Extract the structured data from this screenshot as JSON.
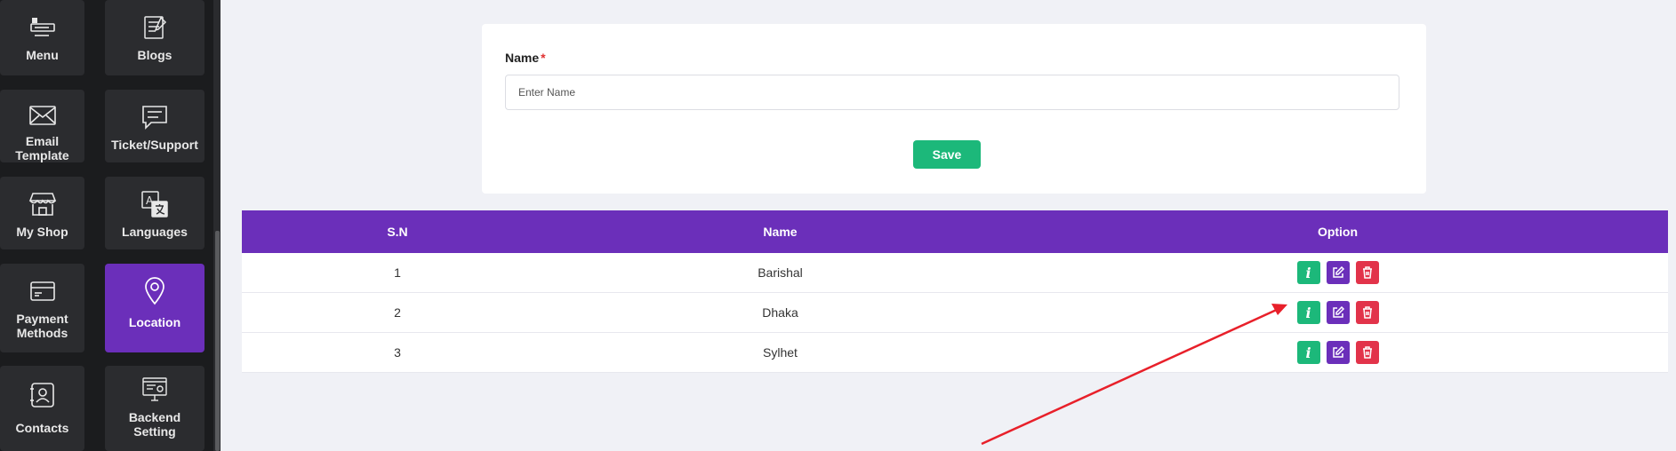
{
  "sidebar": {
    "items": [
      {
        "label": "Menu",
        "icon": "menu-icon"
      },
      {
        "label": "Blogs",
        "icon": "blog-icon"
      },
      {
        "label": "Email Template",
        "icon": "envelope-icon"
      },
      {
        "label": "Ticket/Support",
        "icon": "chat-icon"
      },
      {
        "label": "My Shop",
        "icon": "shop-icon"
      },
      {
        "label": "Languages",
        "icon": "translate-icon"
      },
      {
        "label": "Payment Methods",
        "icon": "card-icon"
      },
      {
        "label": "Location",
        "icon": "location-pin-icon",
        "active": true
      },
      {
        "label": "Contacts",
        "icon": "contact-book-icon"
      },
      {
        "label": "Backend Setting",
        "icon": "settings-monitor-icon"
      }
    ]
  },
  "form": {
    "name_label": "Name",
    "required_mark": "*",
    "name_placeholder": "Enter Name",
    "name_value": "",
    "save_label": "Save"
  },
  "table": {
    "headers": [
      "S.N",
      "Name",
      "Option"
    ],
    "rows": [
      {
        "sn": "1",
        "name": "Barishal"
      },
      {
        "sn": "2",
        "name": "Dhaka"
      },
      {
        "sn": "3",
        "name": "Sylhet"
      }
    ],
    "info_glyph": "i"
  },
  "colors": {
    "accent_purple": "#6b2fba",
    "success_green": "#1cb87a",
    "danger_red": "#e2334a",
    "annotation_arrow": "#e8202a"
  }
}
